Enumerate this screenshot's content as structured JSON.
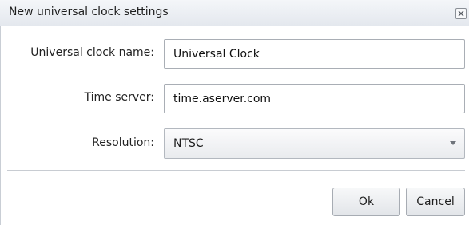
{
  "window": {
    "title": "New universal clock settings",
    "close_icon": "close-icon"
  },
  "form": {
    "name_label": "Universal clock name:",
    "name_value": "Universal Clock",
    "server_label": "Time server:",
    "server_value": "time.aserver.com",
    "resolution_label": "Resolution:",
    "resolution_value": "NTSC"
  },
  "buttons": {
    "ok_label": "Ok",
    "cancel_label": "Cancel"
  }
}
